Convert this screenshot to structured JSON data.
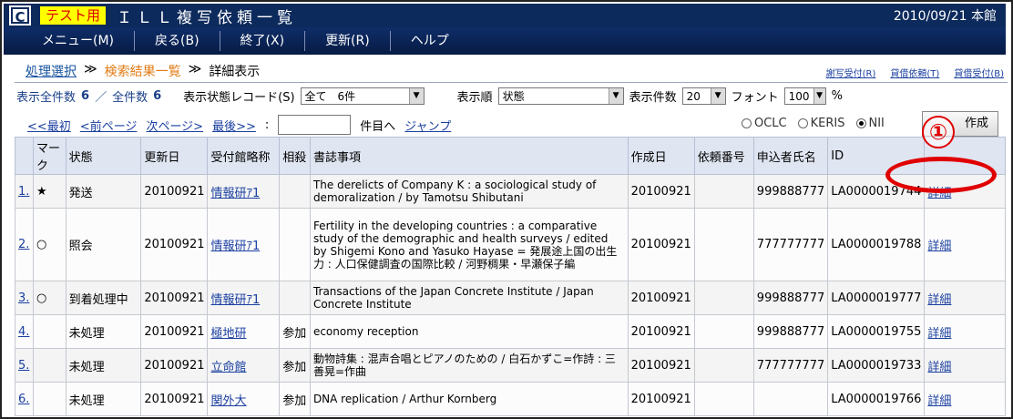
{
  "header": {
    "logo": "C",
    "test_badge": "テスト用",
    "title": "ＩＬＬ複写依頼一覧",
    "date_location": "2010/09/21 本館"
  },
  "menu": [
    {
      "label": "メニュー(M)"
    },
    {
      "label": "戻る(B)"
    },
    {
      "label": "終了(X)"
    },
    {
      "label": "更新(R)"
    },
    {
      "label": "ヘルプ"
    }
  ],
  "breadcrumb": {
    "item1": "処理選択",
    "sep": "≫",
    "item2": "検索結果一覧",
    "item3": "詳細表示"
  },
  "top_links": [
    "謝写受付(R)",
    "貸借依頼(T)",
    "貸借受付(B)"
  ],
  "counts": {
    "display_total_label": "表示全件数",
    "display_total": "6",
    "slash": "／",
    "total_label": "全件数",
    "total": "6",
    "status_record_label": "表示状態レコード(S)",
    "status_record_value": "全て　6件",
    "order_label": "表示順",
    "order_value": "状態",
    "per_page_label": "表示件数",
    "per_page_value": "20",
    "font_label": "フォント",
    "font_value": "100",
    "font_unit": "%"
  },
  "nav": {
    "first": "<<最初",
    "prev": "<前ページ",
    "next": "次ページ>",
    "last": "最後>>",
    "colon": ":",
    "goto_suffix": "件目へ",
    "jump": "ジャンプ"
  },
  "radios": [
    {
      "label": "OCLC",
      "checked": false
    },
    {
      "label": "KERIS",
      "checked": false
    },
    {
      "label": "NII",
      "checked": true
    }
  ],
  "create_button": "作成",
  "callout": "①",
  "table": {
    "headers": [
      "",
      "マーク",
      "状態",
      "更新日",
      "受付館略称",
      "相殺",
      "書誌事項",
      "作成日",
      "依頼番号",
      "申込者氏名",
      "ID",
      ""
    ],
    "rows": [
      {
        "no": "1.",
        "mark": "★",
        "status": "発送",
        "updated": "20100921",
        "lib": "情報研ｱ1",
        "offset": "",
        "bib": "The derelicts of Company K : a sociological study of demoralization / by Tamotsu Shibutani",
        "created": "20100921",
        "req_no": "",
        "applicant": "999888777",
        "id": "LA0000019744",
        "detail": "詳細"
      },
      {
        "no": "2.",
        "mark": "○",
        "status": "照会",
        "updated": "20100921",
        "lib": "情報研ｱ1",
        "offset": "",
        "bib": "Fertility in the developing countries : a comparative study of the demographic and health surveys / edited by Shigemi Kono and Yasuko Hayase = 発展途上国の出生力 : 人口保健調査の国際比較 / 河野稠果・早瀬保子編",
        "created": "20100921",
        "req_no": "",
        "applicant": "777777777",
        "id": "LA0000019788",
        "detail": "詳細"
      },
      {
        "no": "3.",
        "mark": "○",
        "status": "到着処理中",
        "updated": "20100921",
        "lib": "情報研ｱ1",
        "offset": "",
        "bib": "Transactions of the Japan Concrete Institute / Japan Concrete Institute",
        "created": "20100921",
        "req_no": "",
        "applicant": "999888777",
        "id": "LA0000019777",
        "detail": "詳細"
      },
      {
        "no": "4.",
        "mark": "",
        "status": "未処理",
        "updated": "20100921",
        "lib": "極地研",
        "offset": "参加",
        "bib": "economy reception",
        "created": "20100921",
        "req_no": "",
        "applicant": "999888777",
        "id": "LA0000019755",
        "detail": "詳細"
      },
      {
        "no": "5.",
        "mark": "",
        "status": "未処理",
        "updated": "20100921",
        "lib": "立命館",
        "offset": "参加",
        "bib": "動物詩集 : 混声合唱とピアノのための / 白石かずこ=作詩 : 三善晃=作曲",
        "created": "20100921",
        "req_no": "",
        "applicant": "777777777",
        "id": "LA0000019733",
        "detail": "詳細"
      },
      {
        "no": "6.",
        "mark": "",
        "status": "未処理",
        "updated": "20100921",
        "lib": "関外大",
        "offset": "参加",
        "bib": "DNA replication / Arthur Kornberg",
        "created": "20100921",
        "req_no": "",
        "applicant": "",
        "id": "LA0000019766",
        "detail": "詳細"
      }
    ]
  }
}
